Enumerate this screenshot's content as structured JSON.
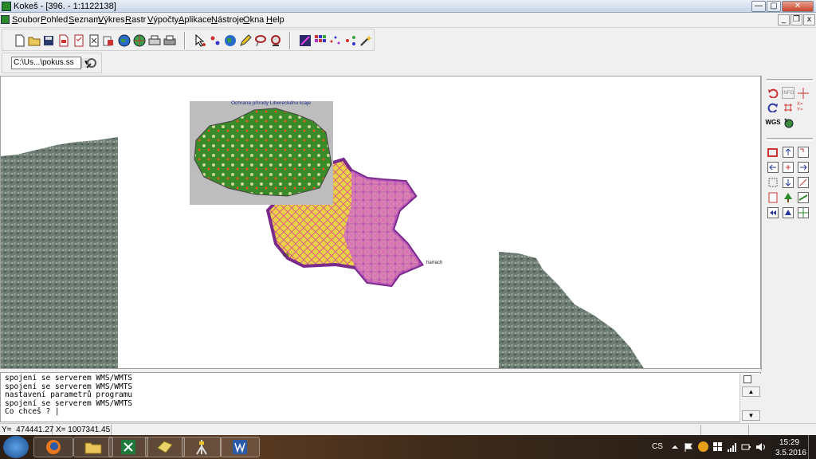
{
  "window": {
    "title": "Kokeš - [396. - 1:1122138]",
    "minimize_glyph": "—",
    "maximize_glyph": "▢",
    "close_glyph": "✕"
  },
  "menu": {
    "items": [
      {
        "label": "Soubor",
        "accel": "S",
        "rest": "oubor"
      },
      {
        "label": "Pohled",
        "accel": "P",
        "rest": "ohled"
      },
      {
        "label": "Seznam",
        "accel": "S",
        "rest": "eznam"
      },
      {
        "label": "Výkres",
        "accel": "V",
        "rest": "ýkres"
      },
      {
        "label": "Rastr",
        "accel": "R",
        "rest": "astr"
      },
      {
        "label": "Výpočty",
        "accel": "V",
        "rest": "ýpočty"
      },
      {
        "label": "Aplikace",
        "accel": "A",
        "rest": "plikace"
      },
      {
        "label": "Nástroje",
        "accel": "N",
        "rest": "ástroje"
      },
      {
        "label": "Okna",
        "accel": "O",
        "rest": "kna"
      },
      {
        "label": "Help",
        "accel": "H",
        "rest": "elp"
      }
    ],
    "mdi_minimize": "_",
    "mdi_restore": "❐",
    "mdi_close": "x"
  },
  "toolbar": {
    "file_select_value": "C:\\Us...\\pokus.ss",
    "file_select_arrow": "▼"
  },
  "map": {
    "inset_title": "Ochrana přírody Libereckého kraje",
    "label_harrach": "harrach",
    "label_ob": "Ob"
  },
  "right_panel": {
    "info_label": "INFO",
    "wgs_label": "WGS",
    "xy_label": "X= Y="
  },
  "console": {
    "lines": [
      "spojení se serverem WMS/WMTS",
      "spojení se serverem WMS/WMTS",
      "nastavení parametrů programu",
      "spojení se serverem WMS/WMTS",
      "Co chceš ? |"
    ],
    "scroll_up": "▲",
    "scroll_down": "▼"
  },
  "status": {
    "y_label": "Y=",
    "y_value": "474441.27",
    "x_label": "X=",
    "x_value": "1007341.45"
  },
  "taskbar": {
    "language": "CS",
    "time": "15:29",
    "date": "3.5.2016"
  },
  "colors": {
    "region_purple": "#7a2a8a",
    "region_yellow": "#e8d24a",
    "region_pink": "#d870c8",
    "forest_green": "#2f7a22",
    "satellite": "#6c7c72"
  }
}
